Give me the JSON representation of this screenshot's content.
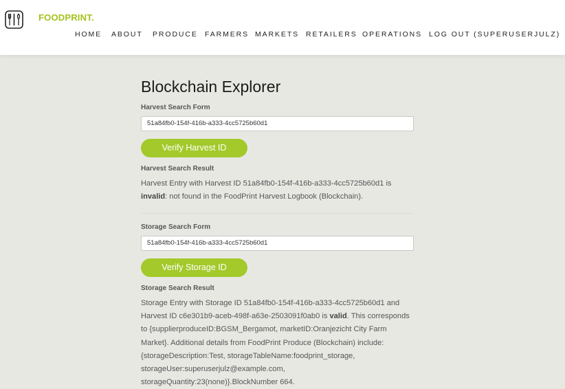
{
  "brand": {
    "name": "FOODPRINT.",
    "accent": "#a3c21c"
  },
  "nav": {
    "items": [
      "HOME",
      "ABOUT",
      "PRODUCE",
      "FARMERS",
      "MARKETS",
      "RETAILERS",
      "OPERATIONS",
      "LOG OUT (SUPERUSERJULZ)"
    ]
  },
  "page": {
    "title": "Blockchain Explorer"
  },
  "harvest": {
    "form_label": "Harvest Search Form",
    "input_value": "51a84fb0-154f-416b-a333-4cc5725b60d1",
    "button_label": "Verify Harvest ID",
    "result_label": "Harvest Search Result",
    "result_pre": "Harvest Entry with Harvest ID 51a84fb0-154f-416b-a333-4cc5725b60d1 is",
    "result_status": "invalid",
    "result_post": ": not found in the FoodPrint Harvest Logbook (Blockchain)."
  },
  "storage": {
    "form_label": "Storage Search Form",
    "input_value": "51a84fb0-154f-416b-a333-4cc5725b60d1",
    "button_label": "Verify Storage ID",
    "result_label": "Storage Search Result",
    "result_pre": "Storage Entry with Storage ID 51a84fb0-154f-416b-a333-4cc5725b60d1 and Harvest ID c6e301b9-aceb-498f-a63e-2503091f0ab0 is",
    "result_status": "valid",
    "result_post": ". This corresponds to {supplierproduceID:BGSM_Bergamot, marketID:Oranjezicht City Farm Market}. Additional details from FoodPrint Produce (Blockchain) include: {storageDescription:Test, storageTableName:foodprint_storage, storageUser:superuserjulz@example.com, storageQuantity:23(none)}.BlockNumber 664."
  }
}
